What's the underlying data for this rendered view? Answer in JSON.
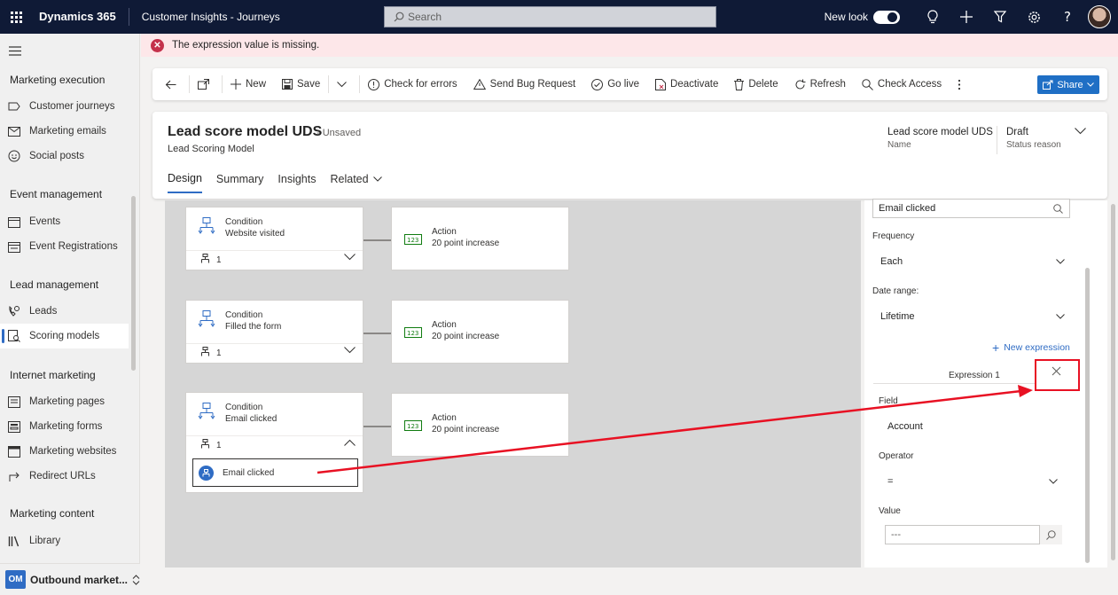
{
  "topbar": {
    "brand": "Dynamics 365",
    "app_name": "Customer Insights - Journeys",
    "search_placeholder": "Search",
    "new_look_label": "New look"
  },
  "sidebar": {
    "sections": [
      {
        "title": "Marketing execution",
        "items": [
          {
            "label": "Customer journeys",
            "icon": "journey-icon"
          },
          {
            "label": "Marketing emails",
            "icon": "mail-icon"
          },
          {
            "label": "Social posts",
            "icon": "social-icon"
          }
        ]
      },
      {
        "title": "Event management",
        "items": [
          {
            "label": "Events",
            "icon": "calendar-icon"
          },
          {
            "label": "Event Registrations",
            "icon": "registration-icon"
          }
        ]
      },
      {
        "title": "Lead management",
        "items": [
          {
            "label": "Leads",
            "icon": "leads-icon"
          },
          {
            "label": "Scoring models",
            "icon": "scoring-icon",
            "active": true
          }
        ]
      },
      {
        "title": "Internet marketing",
        "items": [
          {
            "label": "Marketing pages",
            "icon": "page-icon"
          },
          {
            "label": "Marketing forms",
            "icon": "form-icon"
          },
          {
            "label": "Marketing websites",
            "icon": "website-icon"
          },
          {
            "label": "Redirect URLs",
            "icon": "redirect-icon"
          }
        ]
      },
      {
        "title": "Marketing content",
        "items": [
          {
            "label": "Library",
            "icon": "library-icon"
          }
        ]
      }
    ],
    "area": {
      "badge": "OM",
      "label": "Outbound market..."
    }
  },
  "error_banner": {
    "message": "The expression value is missing."
  },
  "commands": {
    "new": "New",
    "save": "Save",
    "check_errors": "Check for errors",
    "send_bug": "Send Bug Request",
    "go_live": "Go live",
    "deactivate": "Deactivate",
    "delete": "Delete",
    "refresh": "Refresh",
    "check_access": "Check Access",
    "share": "Share"
  },
  "record": {
    "title": "Lead score model UDS",
    "unsaved": "- Unsaved",
    "entity": "Lead Scoring Model",
    "header_fields": [
      {
        "value": "Lead score model UDS",
        "label": "Name"
      },
      {
        "value": "Draft",
        "label": "Status reason"
      }
    ],
    "tabs": [
      "Design",
      "Summary",
      "Insights",
      "Related"
    ]
  },
  "canvas": {
    "rows": [
      {
        "condition_type": "Condition",
        "condition_name": "Website visited",
        "count": "1",
        "action_type": "Action",
        "action_name": "20 point increase"
      },
      {
        "condition_type": "Condition",
        "condition_name": "Filled the form",
        "count": "1",
        "action_type": "Action",
        "action_name": "20 point increase"
      },
      {
        "condition_type": "Condition",
        "condition_name": "Email clicked",
        "count": "1",
        "action_type": "Action",
        "action_name": "20 point increase"
      }
    ],
    "expanded_item": "Email clicked"
  },
  "properties": {
    "trigger_value": "Email clicked",
    "frequency_label": "Frequency",
    "frequency_value": "Each",
    "date_range_label": "Date range:",
    "date_range_value": "Lifetime",
    "new_expression": "New expression",
    "expression_title": "Expression 1",
    "field_label": "Field",
    "field_value": "Account",
    "operator_label": "Operator",
    "operator_value": "=",
    "value_label": "Value",
    "value_placeholder": "---"
  },
  "colors": {
    "topbar": "#0f1a36",
    "accent": "#2f6cc4",
    "error": "#c4314b",
    "annotation": "#e81123"
  }
}
